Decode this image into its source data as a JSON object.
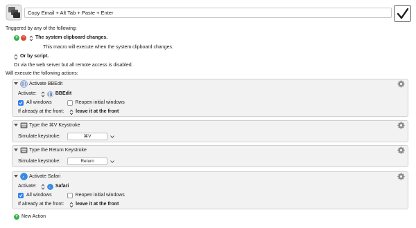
{
  "macro": {
    "name": "Copy Email + Alt Tab + Paste + Enter",
    "enabled": true
  },
  "triggers": {
    "heading": "Triggered by any of the following:",
    "clipboard_trigger": "The system clipboard changes.",
    "clipboard_description": "This macro will execute when the system clipboard changes.",
    "script_trigger": "Or by script.",
    "web_server_note": "Or via the web server but all remote access is disabled."
  },
  "actions_heading": "Will execute the following actions:",
  "actions": [
    {
      "title": "Activate BBEdit",
      "icon": "bbedit-icon",
      "activate_label": "Activate:",
      "app": "BBEdit",
      "all_windows_label": "All windows",
      "all_windows_checked": true,
      "reopen_label": "Reopen initial windows",
      "reopen_checked": false,
      "front_label": "If already at the front:",
      "front_value": "leave it at the front"
    },
    {
      "title": "Type the ⌘V Keystroke",
      "icon": "keyboard-icon",
      "simulate_label": "Simulate keystroke:",
      "keystroke": "⌘V"
    },
    {
      "title": "Type the Return Keystroke",
      "icon": "keyboard-icon",
      "simulate_label": "Simulate keystroke:",
      "keystroke": "Return"
    },
    {
      "title": "Activate Safari",
      "icon": "safari-icon",
      "activate_label": "Activate:",
      "app": "Safari",
      "all_windows_label": "All windows",
      "all_windows_checked": true,
      "reopen_label": "Reopen initial windows",
      "reopen_checked": false,
      "front_label": "If already at the front:",
      "front_value": "leave it at the front"
    }
  ],
  "new_action_label": "New Action",
  "colors": {
    "accent": "#2f7ff0",
    "add_green": "#34b34a",
    "remove_red": "#e0463c"
  }
}
